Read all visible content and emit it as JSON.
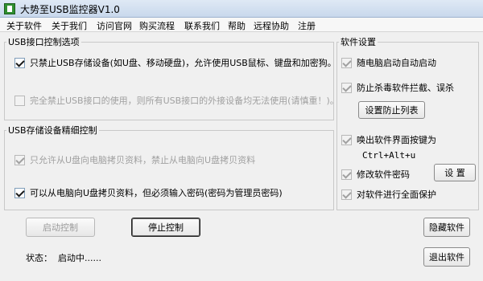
{
  "window": {
    "title": "大势至USB监控器V1.0"
  },
  "menu": [
    "关于软件",
    "关于我们",
    "访问官网",
    "购买流程",
    "联系我们",
    "帮助",
    "远程协助",
    "注册"
  ],
  "usb_port_group": {
    "title": "USB接口控制选项",
    "option_storage_only": {
      "label": "只禁止USB存储设备(如U盘、移动硬盘)，允许使用USB鼠标、键盘和加密狗。",
      "checked": true,
      "enabled": true
    },
    "option_disable_all": {
      "label": "完全禁止USB接口的使用，则所有USB接口的外接设备均无法使用(请慎重！)。",
      "checked": false,
      "enabled": false
    }
  },
  "usb_storage_group": {
    "title": "USB存储设备精细控制",
    "option_read_only": {
      "label": "只允许从U盘向电脑拷贝资料，禁止从电脑向U盘拷贝资料",
      "checked": true,
      "enabled": false
    },
    "option_password_copy": {
      "label": "可以从电脑向U盘拷贝资料，但必须输入密码(密码为管理员密码)",
      "checked": true,
      "enabled": true
    }
  },
  "settings_group": {
    "title": "软件设置",
    "autostart": {
      "label": "随电脑启动自动启动",
      "checked": true,
      "enabled": false
    },
    "antivirus": {
      "label": "防止杀毒软件拦截、误杀",
      "checked": true,
      "enabled": false
    },
    "antivirus_button": "设置防止列表",
    "hotkey": {
      "label": "唤出软件界面按键为",
      "checked": true,
      "enabled": false
    },
    "hotkey_value": "Ctrl+Alt+u",
    "password": {
      "label": "修改软件密码",
      "checked": true,
      "enabled": false
    },
    "password_button": "设 置",
    "protect": {
      "label": "对软件进行全面保护",
      "checked": true,
      "enabled": false
    }
  },
  "buttons": {
    "start": "启动控制",
    "stop": "停止控制",
    "hide": "隐藏软件",
    "exit": "退出软件"
  },
  "status": {
    "label": "状态：",
    "value": "启动中......"
  }
}
